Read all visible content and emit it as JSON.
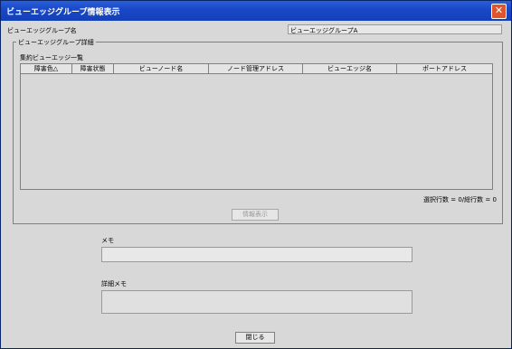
{
  "window": {
    "title": "ビューエッジグループ情報表示"
  },
  "group_name": {
    "label": "ビューエッジグループ名",
    "value": "ビューエッジグループA"
  },
  "detail": {
    "legend": "ビューエッジグループ詳細",
    "list_label": "集約ビューエッジ一覧",
    "columns": [
      "障害色",
      "障害状態",
      "ビューノード名",
      "ノード管理アドレス",
      "ビューエッジ名",
      "ポートアドレス"
    ],
    "sort_indicator": "△",
    "count_text": "選択行数 = 0/総行数 = 0",
    "info_button": "情報表示"
  },
  "memo": {
    "label": "メモ",
    "value": ""
  },
  "detail_memo": {
    "label": "詳細メモ",
    "value": ""
  },
  "close_button": "閉じる"
}
